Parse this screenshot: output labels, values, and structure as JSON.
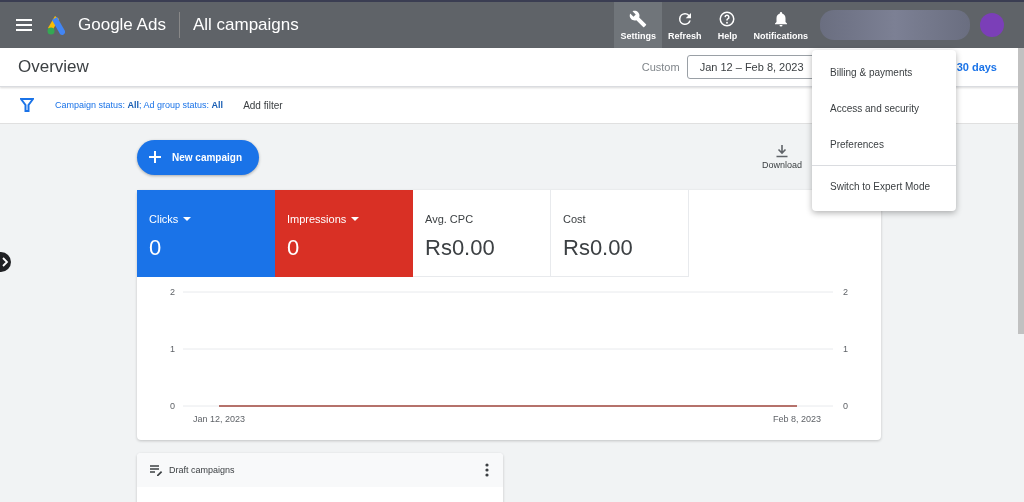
{
  "header": {
    "product": "Google Ads",
    "title": "All campaigns",
    "toolbar": [
      {
        "kind": "settings",
        "label": "Settings",
        "selected": true
      },
      {
        "kind": "refresh",
        "label": "Refresh",
        "selected": false
      },
      {
        "kind": "help",
        "label": "Help",
        "selected": false
      },
      {
        "kind": "notifications",
        "label": "Notifications",
        "selected": false
      }
    ]
  },
  "page": {
    "title": "Overview",
    "date_label": "Custom",
    "date_range": "Jan 12 – Feb 8, 2023",
    "preset": "30 days"
  },
  "filter_bar": {
    "filters": "Campaign status: **All**; Ad group status: **All**",
    "add_filter": "Add filter"
  },
  "new_campaign": "New campaign",
  "download": "Download",
  "metrics": [
    {
      "label": "Clicks",
      "value": "0",
      "color": "#1a73e8",
      "dropdown": true
    },
    {
      "label": "Impressions",
      "value": "0",
      "color": "#d93025",
      "dropdown": true
    },
    {
      "label": "Avg. CPC",
      "value": "Rs0.00",
      "dropdown": false
    },
    {
      "label": "Cost",
      "value": "Rs0.00",
      "dropdown": false
    }
  ],
  "chart_data": {
    "type": "line",
    "categories": [
      "Jan 12, 2023",
      "Feb 8, 2023"
    ],
    "series": [
      {
        "color": "#a0463c",
        "values": [
          0,
          0
        ]
      }
    ],
    "ylim": [
      0,
      2
    ],
    "yticks": [
      0,
      1,
      2
    ]
  },
  "chart_right_axis": [
    "2",
    "1",
    "0"
  ],
  "draft_card": {
    "title": "Draft campaigns"
  },
  "settings_menu": [
    {
      "label": "Billing & payments",
      "divider_before": false
    },
    {
      "label": "Access and security",
      "divider_before": false
    },
    {
      "label": "Preferences",
      "divider_before": false
    },
    {
      "label": "Switch to Expert Mode",
      "divider_before": true
    }
  ]
}
